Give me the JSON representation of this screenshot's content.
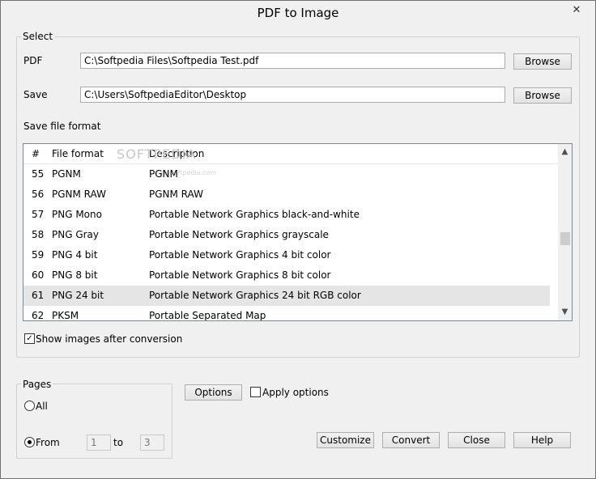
{
  "window": {
    "title": "PDF to Image",
    "close_label": "✕"
  },
  "select_group": {
    "label": "Select",
    "pdf_label": "PDF",
    "pdf_value": "C:\\Softpedia Files\\Softpedia Test.pdf",
    "browse_label": "Browse",
    "save_label": "Save",
    "save_value": "C:\\Users\\SoftpediaEditor\\Desktop",
    "format_label": "Save file format"
  },
  "format_list": {
    "headers": {
      "num": "#",
      "format": "File format",
      "description": "Description"
    },
    "rows": [
      {
        "num": "55",
        "format": "PGNM",
        "description": "PGNM"
      },
      {
        "num": "56",
        "format": "PGNM RAW",
        "description": "PGNM RAW"
      },
      {
        "num": "57",
        "format": "PNG Mono",
        "description": "Portable Network Graphics black-and-white"
      },
      {
        "num": "58",
        "format": "PNG Gray",
        "description": "Portable Network Graphics grayscale"
      },
      {
        "num": "59",
        "format": "PNG 4 bit",
        "description": "Portable Network Graphics 4 bit color"
      },
      {
        "num": "60",
        "format": "PNG 8 bit",
        "description": "Portable Network Graphics 8 bit color"
      },
      {
        "num": "61",
        "format": "PNG 24 bit",
        "description": "Portable Network Graphics 24 bit RGB color"
      },
      {
        "num": "62",
        "format": "PKSM",
        "description": "Portable Separated Map"
      }
    ],
    "selected_index": 6,
    "scroll_up_icon": "▲",
    "scroll_down_icon": "▼"
  },
  "watermark": {
    "text": "SOFTPEDIA",
    "sub": "www.softpedia.com"
  },
  "show_images": {
    "label": "Show images after conversion",
    "checked": true,
    "check_glyph": "✓"
  },
  "pages_group": {
    "label": "Pages",
    "all_label": "All",
    "from_label": "From",
    "from_value": "1",
    "to_label": "to",
    "to_value": "3",
    "selected": "From"
  },
  "options": {
    "button_label": "Options",
    "apply_label": "Apply options",
    "apply_checked": false
  },
  "actions": {
    "customize": "Customize",
    "convert": "Convert",
    "close": "Close",
    "help": "Help"
  }
}
